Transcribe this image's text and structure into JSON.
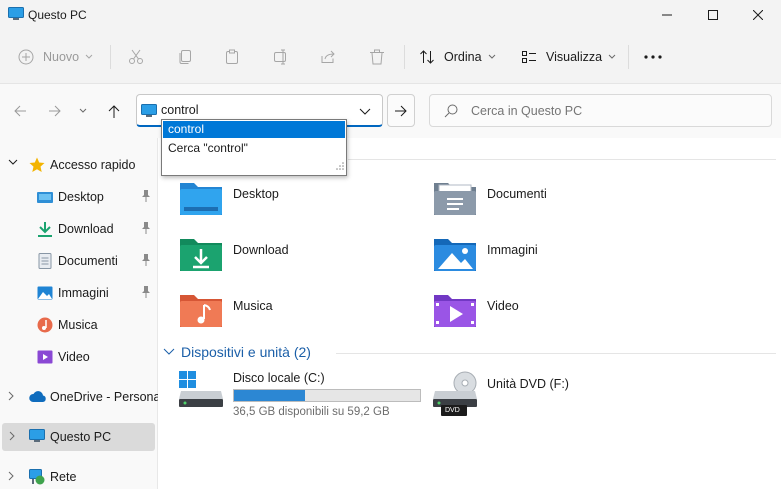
{
  "window": {
    "title": "Questo PC",
    "minimize_icon": "minimize-icon",
    "maximize_icon": "maximize-icon",
    "close_icon": "close-icon"
  },
  "toolbar": {
    "new_label": "Nuovo",
    "sort_label": "Ordina",
    "view_label": "Visualizza",
    "more_icon": "more-icon"
  },
  "address": {
    "value": "control",
    "search_placeholder": "Cerca in Questo PC"
  },
  "suggestions": [
    {
      "label": "control",
      "selected": true
    },
    {
      "label": "Cerca \"control\"",
      "selected": false
    }
  ],
  "sidebar": {
    "items": [
      {
        "label": "Accesso rapido"
      },
      {
        "label": "Desktop"
      },
      {
        "label": "Download"
      },
      {
        "label": "Documenti"
      },
      {
        "label": "Immagini"
      },
      {
        "label": "Musica"
      },
      {
        "label": "Video"
      },
      {
        "label": "OneDrive - Personal"
      },
      {
        "label": "Questo PC"
      },
      {
        "label": "Rete"
      }
    ]
  },
  "main": {
    "folders": [
      {
        "label": "Desktop"
      },
      {
        "label": "Documenti"
      },
      {
        "label": "Download"
      },
      {
        "label": "Immagini"
      },
      {
        "label": "Musica"
      },
      {
        "label": "Video"
      }
    ],
    "devices_header": "Dispositivi e unità (2)",
    "drives": [
      {
        "label": "Disco locale (C:)",
        "free_text": "36,5 GB disponibili su 59,2 GB",
        "used_fraction": 0.38
      },
      {
        "label": "Unità DVD (F:)",
        "badge": "DVD"
      }
    ]
  },
  "colors": {
    "accent": "#0067c0",
    "selection": "#0078d7",
    "drive_bar": "#2c87d3"
  }
}
